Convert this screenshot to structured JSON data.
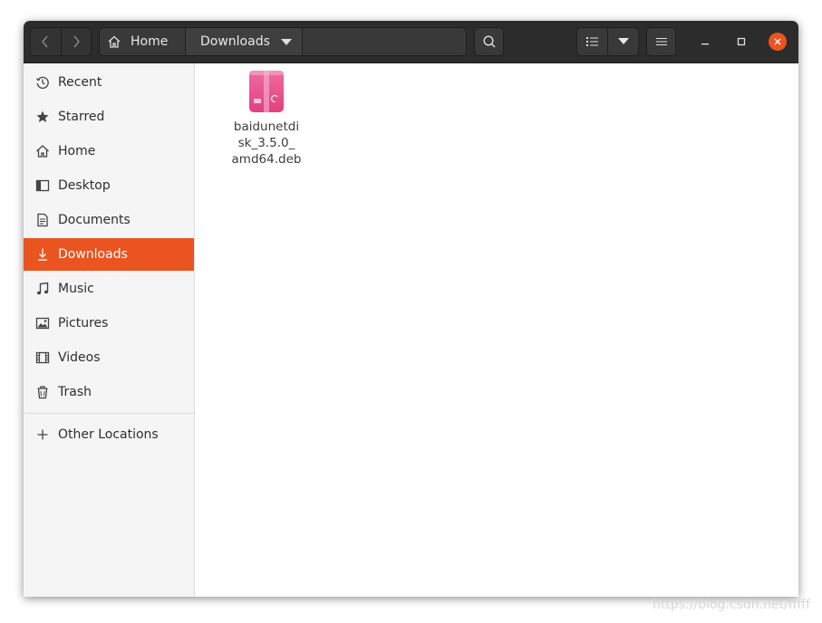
{
  "headerbar": {
    "path": {
      "home": "Home",
      "current": "Downloads"
    }
  },
  "sidebar": {
    "items": [
      {
        "label": "Recent",
        "icon": "clock-icon"
      },
      {
        "label": "Starred",
        "icon": "star-icon"
      },
      {
        "label": "Home",
        "icon": "home-icon"
      },
      {
        "label": "Desktop",
        "icon": "desktop-icon"
      },
      {
        "label": "Documents",
        "icon": "document-icon"
      },
      {
        "label": "Downloads",
        "icon": "download-icon",
        "active": true
      },
      {
        "label": "Music",
        "icon": "music-icon"
      },
      {
        "label": "Pictures",
        "icon": "picture-icon"
      },
      {
        "label": "Videos",
        "icon": "video-icon"
      },
      {
        "label": "Trash",
        "icon": "trash-icon"
      }
    ],
    "other": {
      "label": "Other Locations",
      "icon": "plus-icon"
    }
  },
  "content": {
    "files": [
      {
        "name": "baidunetdisk_3.5.0_amd64.deb",
        "line1": "baidunetdi",
        "line2": "sk_3.5.0_",
        "line3": "amd64.deb",
        "icon": "deb-package-icon"
      }
    ]
  },
  "watermark": "https://blog.csdn.net/fffff",
  "colors": {
    "accent": "#e95420",
    "headerbar": "#2c2c2c",
    "sidebar": "#f5f5f5"
  }
}
